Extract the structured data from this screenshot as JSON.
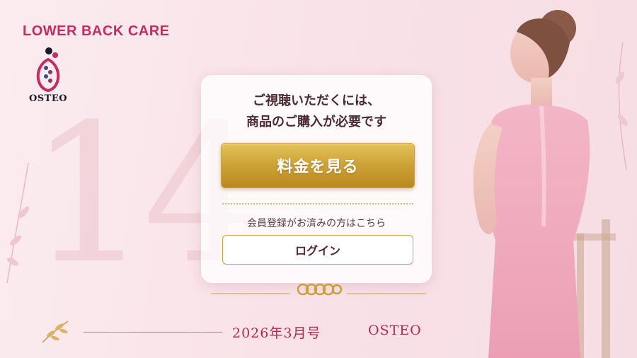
{
  "header": {
    "brand_title": "LOWER BACK CARE",
    "logo_label": "OSTEO"
  },
  "background": {
    "issue_number": "14"
  },
  "card": {
    "message_line1": "ご視聴いただくには、",
    "message_line2": "商品のご購入が必要です",
    "price_button_label": "料金を見る",
    "member_prompt": "会員登録がお済みの方はこちら",
    "login_button_label": "ログイン"
  },
  "footer": {
    "issue_date": "2026年3月号",
    "brand": "OSTEO"
  },
  "colors": {
    "brand_pink": "#c42c61",
    "gold": "#cfa437",
    "background": "#fbecef"
  },
  "icons": [
    "osteo-logo-icon",
    "woman-illustration",
    "gold-rings-ornament-icon",
    "leaf-sprig-icon"
  ]
}
